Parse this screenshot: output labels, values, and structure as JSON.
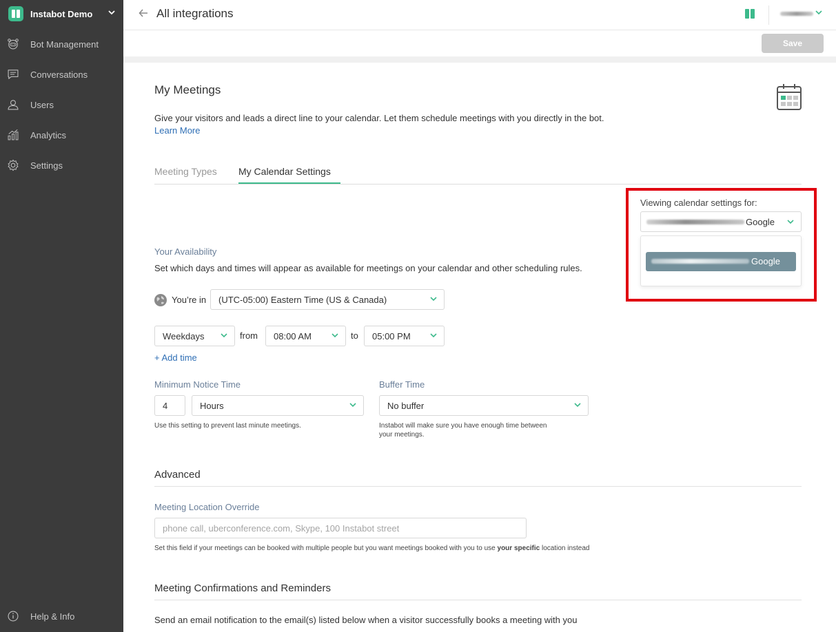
{
  "sidebar": {
    "brand": "Instabot Demo",
    "items": [
      {
        "label": "Bot Management",
        "icon": "bot-icon"
      },
      {
        "label": "Conversations",
        "icon": "chat-icon"
      },
      {
        "label": "Users",
        "icon": "user-icon"
      },
      {
        "label": "Analytics",
        "icon": "analytics-icon"
      },
      {
        "label": "Settings",
        "icon": "gear-icon"
      }
    ],
    "help": "Help & Info"
  },
  "topbar": {
    "title": "All integrations",
    "save_label": "Save"
  },
  "page": {
    "heading": "My Meetings",
    "description": "Give your visitors and leads a direct line to your calendar. Let them schedule meetings with you directly in the bot.",
    "learn_more": "Learn More",
    "tabs": [
      {
        "label": "Meeting Types",
        "active": false
      },
      {
        "label": "My Calendar Settings",
        "active": true
      }
    ]
  },
  "calendar_account": {
    "viewing_label": "Viewing calendar settings for:",
    "selected_provider": "Google",
    "options": [
      {
        "provider": "Google"
      }
    ]
  },
  "availability": {
    "heading": "Your Availability",
    "description": "Set which days and times will appear as available for meetings on your calendar and other scheduling rules.",
    "youre_in_label": "You’re in",
    "timezone": "(UTC-05:00) Eastern Time (US & Canada)",
    "days": "Weekdays",
    "from_label": "from",
    "from_time": "08:00 AM",
    "to_label": "to",
    "to_time": "05:00 PM",
    "add_time": "+ Add time"
  },
  "minimum_notice": {
    "label": "Minimum Notice Time",
    "value": "4",
    "unit": "Hours",
    "help": "Use this setting to prevent last minute meetings."
  },
  "buffer": {
    "label": "Buffer Time",
    "value": "No buffer",
    "help_line1": "Instabot will make sure you have enough time between",
    "help_line2": "your meetings."
  },
  "advanced": {
    "heading": "Advanced",
    "location_label": "Meeting Location Override",
    "location_placeholder": "phone call, uberconference.com, Skype, 100 Instabot street",
    "help_prefix": "Set this field if your meetings can be booked with multiple people but you want meetings booked with you to use ",
    "help_bold": "your specific",
    "help_suffix": " location instead"
  },
  "confirmations": {
    "heading": "Meeting Confirmations and Reminders",
    "description": "Send an email notification to the email(s) listed below when a visitor successfully books a meeting with you"
  },
  "colors": {
    "accent": "#3dba8c",
    "sidebar_bg": "#3b3b3b",
    "link": "#2f6fb5",
    "highlight_box": "#e0000f",
    "selected_option": "#74909b"
  }
}
